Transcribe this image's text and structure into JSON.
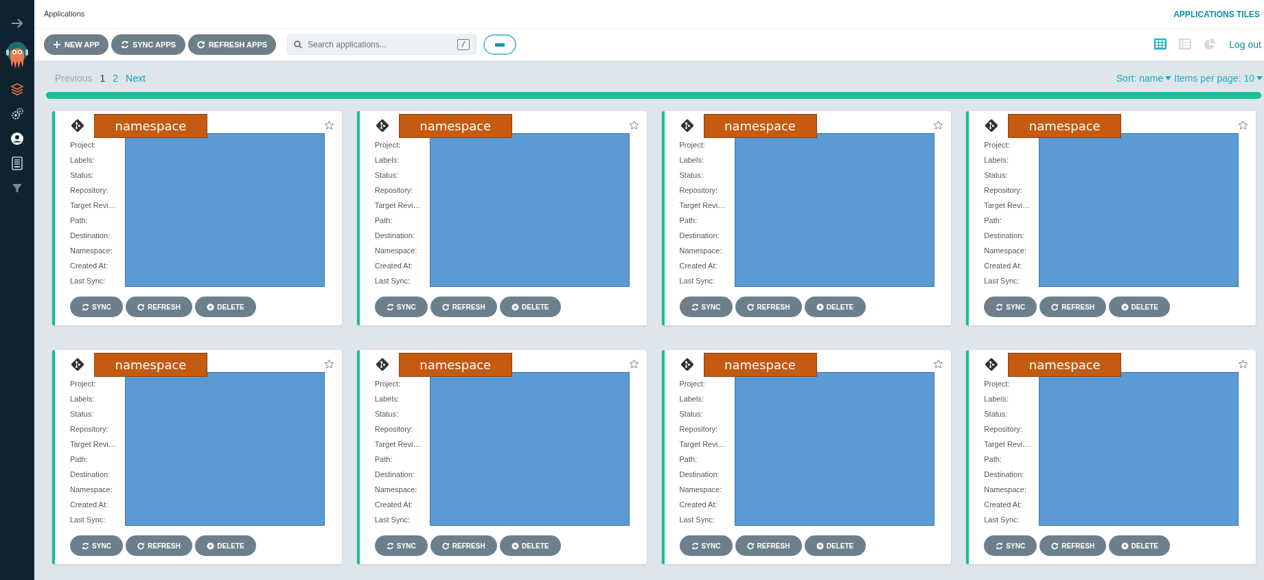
{
  "sidebar": {
    "items": [
      {
        "kind": "applications",
        "selected": true
      },
      {
        "kind": "settings",
        "selected": false
      },
      {
        "kind": "user",
        "selected": false
      },
      {
        "kind": "docs",
        "selected": false
      }
    ]
  },
  "header": {
    "title": "Applications",
    "view_title": "APPLICATIONS TILES"
  },
  "toolbar": {
    "buttons": [
      {
        "kind": "new",
        "label": "NEW APP"
      },
      {
        "kind": "sync",
        "label": "SYNC APPS"
      },
      {
        "kind": "refresh",
        "label": "REFRESH APPS"
      }
    ],
    "search": {
      "placeholder": "Search applications...",
      "shortcut": "/"
    },
    "views": [
      {
        "kind": "tiles",
        "selected": true
      },
      {
        "kind": "list",
        "selected": false
      },
      {
        "kind": "summary",
        "selected": false
      }
    ],
    "logout": "Log out"
  },
  "pagination": {
    "previous": {
      "label": "Previous",
      "disabled": true
    },
    "pages": [
      {
        "label": "1",
        "selected": true
      },
      {
        "label": "2",
        "selected": false
      }
    ],
    "next": {
      "label": "Next",
      "disabled": false
    },
    "sort": "Sort: name",
    "items_per_page": "Items per page: 10"
  },
  "progress": {
    "level": 1
  },
  "cards": [
    {
      "title": "namespace",
      "fields": [
        "Project:",
        "Labels:",
        "Status:",
        "Repository:",
        "Target Revi…",
        "Path:",
        "Destination:",
        "Namespace:",
        "Created At:",
        "Last Sync:"
      ],
      "buttons": [
        "SYNC",
        "REFRESH",
        "DELETE"
      ]
    },
    {
      "title": "namespace",
      "fields": [
        "Project:",
        "Labels:",
        "Status:",
        "Repository:",
        "Target Revi…",
        "Path:",
        "Destination:",
        "Namespace:",
        "Created At:",
        "Last Sync:"
      ],
      "buttons": [
        "SYNC",
        "REFRESH",
        "DELETE"
      ]
    },
    {
      "title": "namespace",
      "fields": [
        "Project:",
        "Labels:",
        "Status:",
        "Repository:",
        "Target Revi…",
        "Path:",
        "Destination:",
        "Namespace:",
        "Created At:",
        "Last Sync:"
      ],
      "buttons": [
        "SYNC",
        "REFRESH",
        "DELETE"
      ]
    },
    {
      "title": "namespace",
      "fields": [
        "Project:",
        "Labels:",
        "Status:",
        "Repository:",
        "Target Revi…",
        "Path:",
        "Destination:",
        "Namespace:",
        "Created At:",
        "Last Sync:"
      ],
      "buttons": [
        "SYNC",
        "REFRESH",
        "DELETE"
      ]
    },
    {
      "title": "namespace",
      "fields": [
        "Project:",
        "Labels:",
        "Status:",
        "Repository:",
        "Target Revi…",
        "Path:",
        "Destination:",
        "Namespace:",
        "Created At:",
        "Last Sync:"
      ],
      "buttons": [
        "SYNC",
        "REFRESH",
        "DELETE"
      ]
    },
    {
      "title": "namespace",
      "fields": [
        "Project:",
        "Labels:",
        "Status:",
        "Repository:",
        "Target Revi…",
        "Path:",
        "Destination:",
        "Namespace:",
        "Created At:",
        "Last Sync:"
      ],
      "buttons": [
        "SYNC",
        "REFRESH",
        "DELETE"
      ]
    },
    {
      "title": "namespace",
      "fields": [
        "Project:",
        "Labels:",
        "Status:",
        "Repository:",
        "Target Revi…",
        "Path:",
        "Destination:",
        "Namespace:",
        "Created At:",
        "Last Sync:"
      ],
      "buttons": [
        "SYNC",
        "REFRESH",
        "DELETE"
      ]
    },
    {
      "title": "namespace",
      "fields": [
        "Project:",
        "Labels:",
        "Status:",
        "Repository:",
        "Target Revi…",
        "Path:",
        "Destination:",
        "Namespace:",
        "Created At:",
        "Last Sync:"
      ],
      "buttons": [
        "SYNC",
        "REFRESH",
        "DELETE"
      ]
    }
  ]
}
